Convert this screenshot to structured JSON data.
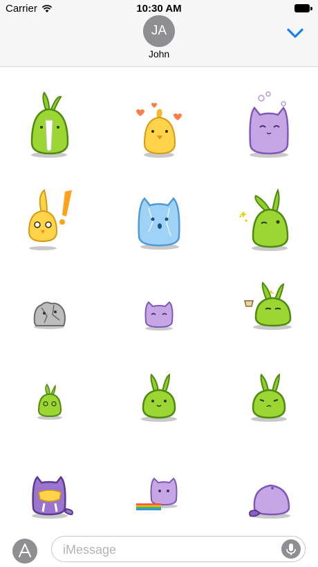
{
  "status_bar": {
    "carrier": "Carrier",
    "time": "10:30 AM",
    "wifi_icon": "wifi-icon",
    "battery_icon": "battery-icon"
  },
  "header": {
    "avatar_initials": "JA",
    "contact_name": "John",
    "collapse_icon": "chevron-down-icon",
    "accent_color": "#1a7ef2"
  },
  "stickers": [
    {
      "name": "green-bunny-drooling"
    },
    {
      "name": "yellow-chick-hearts"
    },
    {
      "name": "purple-cat-bubbles"
    },
    {
      "name": "yellow-bunny-exclamation"
    },
    {
      "name": "blue-cat-frozen"
    },
    {
      "name": "green-bunny-winking"
    },
    {
      "name": "gray-stone-blob"
    },
    {
      "name": "purple-cat-small"
    },
    {
      "name": "green-bunny-tea"
    },
    {
      "name": "green-bunny-dizzy"
    },
    {
      "name": "green-bunny-smiling"
    },
    {
      "name": "green-bunny-frown"
    },
    {
      "name": "purple-cat-eating"
    },
    {
      "name": "purple-cat-rainbow"
    },
    {
      "name": "purple-cat-back"
    }
  ],
  "input_bar": {
    "placeholder": "iMessage",
    "apps_icon": "app-store-icon",
    "mic_icon": "microphone-icon"
  }
}
